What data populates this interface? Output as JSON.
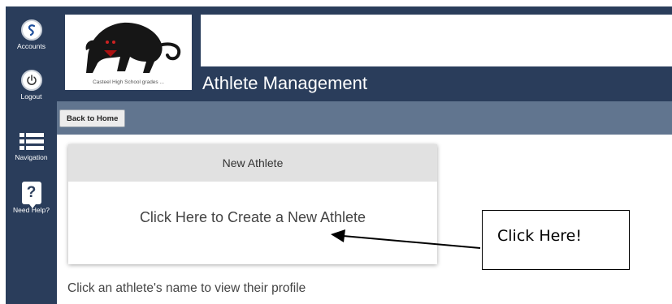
{
  "rail": {
    "accounts_label": "Accounts",
    "logout_label": "Logout",
    "navigation_label": "Navigation",
    "help_label": "Need Help?"
  },
  "header": {
    "logo_caption": "Casteel High School grades ...",
    "title": "Athlete Management"
  },
  "toolbar": {
    "back_label": "Back to Home"
  },
  "card": {
    "header": "New Athlete",
    "body": "Click Here to Create a New Athlete"
  },
  "callout": {
    "text": "Click Here!"
  },
  "hint": "Click an athlete's name to view their profile",
  "colors": {
    "nav_dark": "#2a3d5b",
    "toolbar": "#61758f",
    "card_header": "#e1e1e1"
  },
  "icons": {
    "accounts": "s-logo-icon",
    "logout": "power-icon",
    "navigation": "list-icon",
    "help": "question-icon",
    "logo": "panther-icon"
  }
}
